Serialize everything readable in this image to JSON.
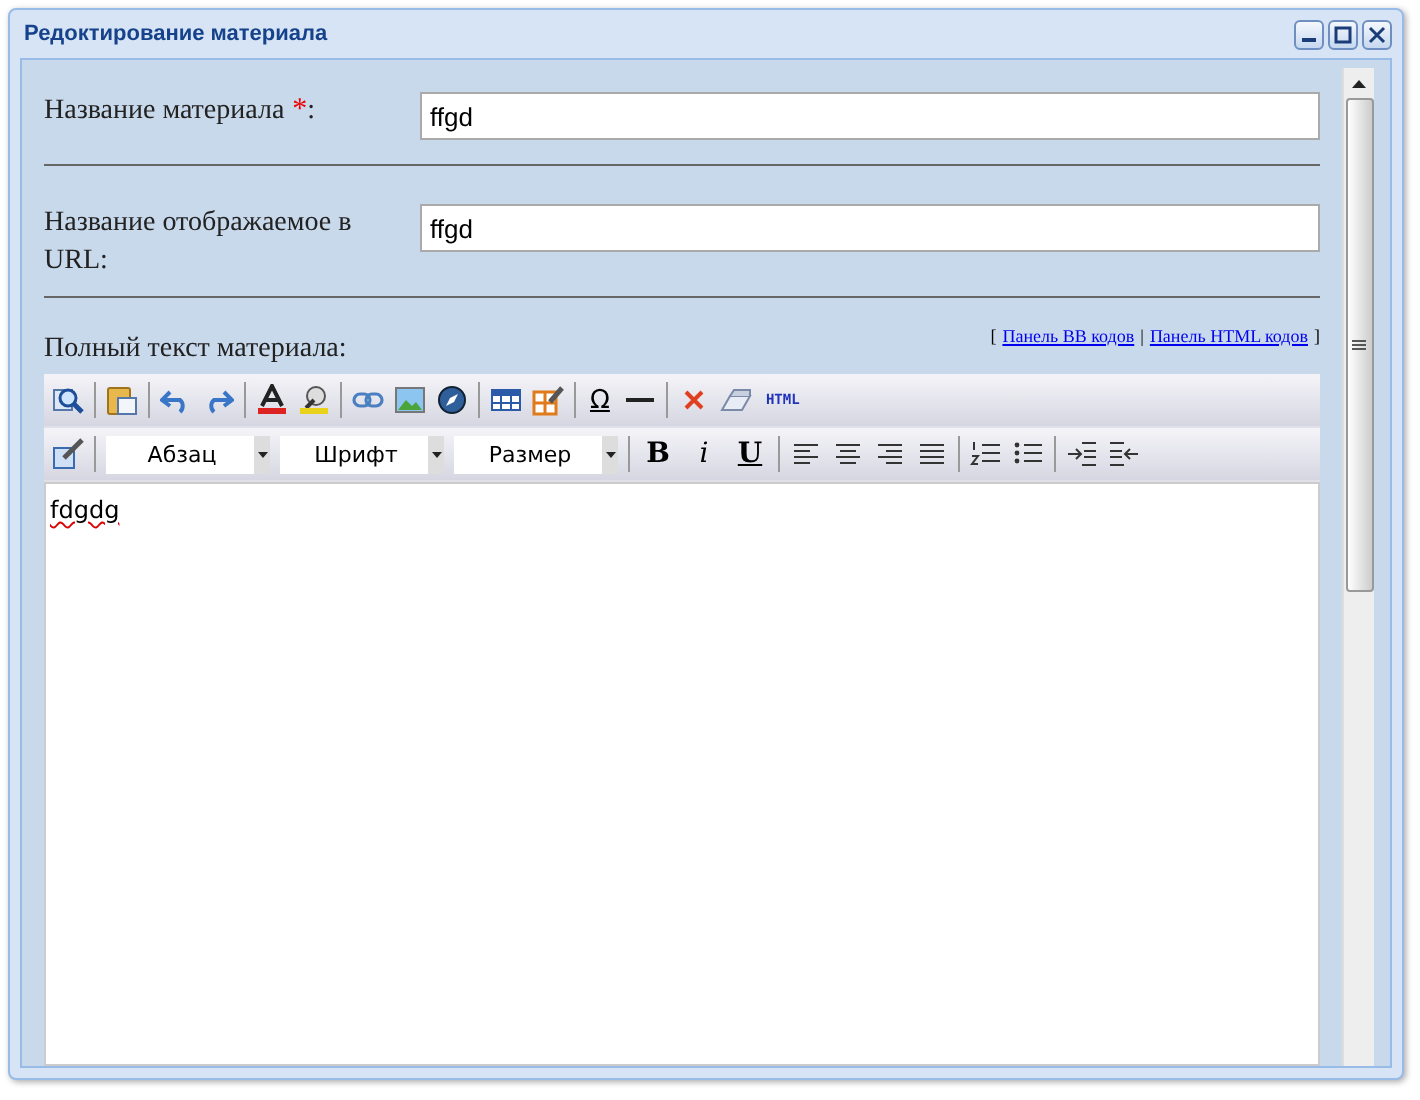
{
  "window": {
    "title": "Редоктирование материала"
  },
  "fields": [
    {
      "label": "Название материала",
      "required": true,
      "required_mark": "*",
      "suffix": ":",
      "value": "ffgd"
    },
    {
      "label": "Название отображаемое в URL:",
      "required": false,
      "value": "ffgd"
    }
  ],
  "editor": {
    "label": "Полный текст материала:",
    "panel_links": {
      "open": "[",
      "links": [
        "Панель BB кодов",
        "Панель HTML кодов"
      ],
      "divider": "|",
      "close": "]"
    },
    "toolbar_1": {
      "symbol": "Ω",
      "html": "HTML"
    },
    "toolbar_2": {
      "dropdowns": [
        "Абзац",
        "Шрифт",
        "Размер"
      ],
      "format": [
        "B",
        "i",
        "U"
      ]
    },
    "content": "fdgdg"
  }
}
